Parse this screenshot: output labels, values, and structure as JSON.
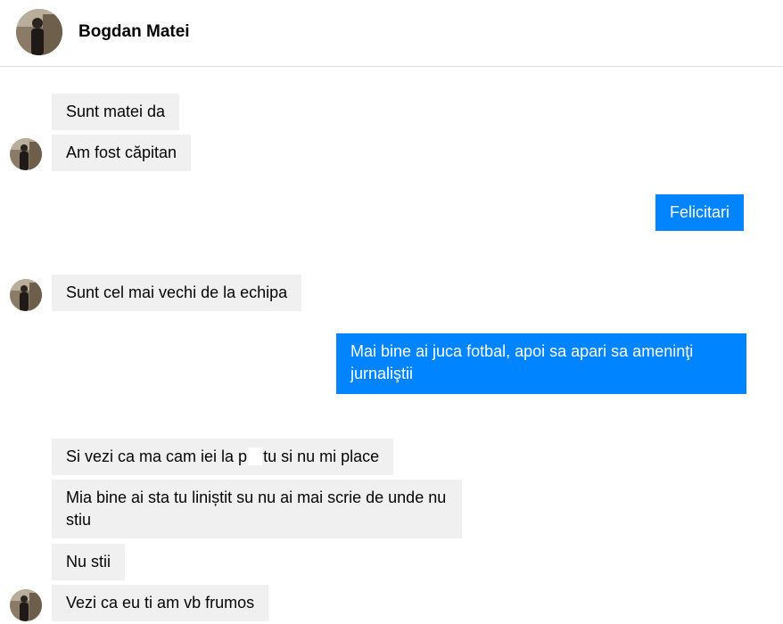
{
  "header": {
    "contact_name": "Bogdan Matei",
    "avatar_icon": "profile-photo"
  },
  "messages": [
    {
      "sender": "Bogdan Matei",
      "text": "Sunt matei da"
    },
    {
      "sender": "Bogdan Matei",
      "text": "Am fost căpitan"
    },
    {
      "sender": "me",
      "text": "Felicitari"
    },
    {
      "sender": "Bogdan Matei",
      "text": "Sunt cel mai vechi de la echipa"
    },
    {
      "sender": "me",
      "text": "Mai bine ai juca fotbal, apoi sa apari sa ameninţi jurnaliştii"
    },
    {
      "sender": "Bogdan Matei",
      "text_before": "Si vezi ca ma cam iei la p",
      "text_after": "tu si nu mi place"
    },
    {
      "sender": "Bogdan Matei",
      "text": "Mia bine ai sta tu liniștit su nu ai mai scrie de unde nu stiu"
    },
    {
      "sender": "Bogdan Matei",
      "text": "Nu stii"
    },
    {
      "sender": "Bogdan Matei",
      "text": "Vezi ca eu ti am vb frumos"
    }
  ],
  "colors": {
    "outgoing_bubble": "#0084ff",
    "incoming_bubble": "#f0f0f0"
  }
}
